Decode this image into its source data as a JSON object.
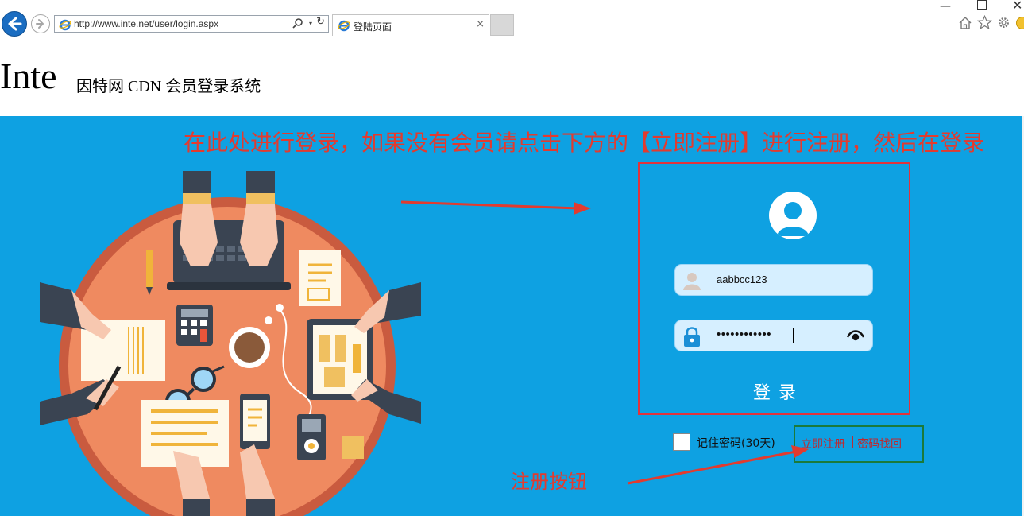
{
  "browser": {
    "url": "http://www.inte.net/user/login.aspx",
    "tab_title": "登陆页面",
    "tab_close": "×",
    "minimize": "—",
    "close": "✕",
    "refresh": "↻",
    "dropdown": "▾"
  },
  "header": {
    "logo": "Inte",
    "subtitle": "因特网 CDN 会员登录系统"
  },
  "annotations": {
    "top_note": "在此处进行登录，如果没有会员请点击下方的【立即注册】进行注册，然后在登录",
    "bottom_note": "注册按钮"
  },
  "login": {
    "username": "aabbcc123",
    "password_mask": "••••••••••••",
    "button": "登录",
    "remember": "记住密码(30天)",
    "register_link": "立即注册",
    "separator": "|",
    "recover_link": "密码找回"
  },
  "colors": {
    "banner": "#0ea1e2",
    "annotation_red": "#e23b2f",
    "login_border": "#e2333b",
    "links_border": "#1b7a3a",
    "link_text": "#c0272d"
  }
}
